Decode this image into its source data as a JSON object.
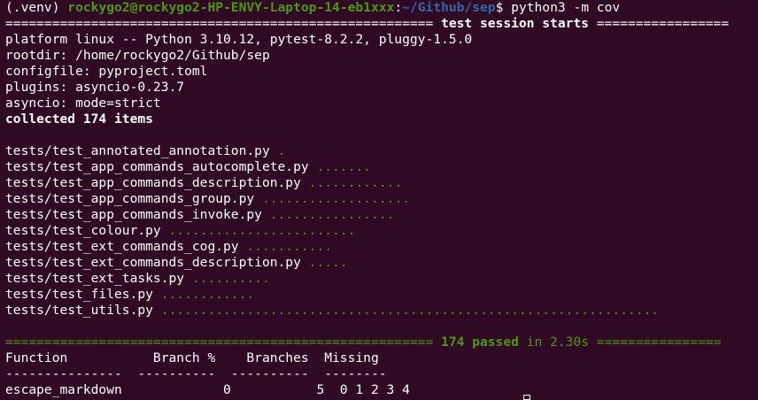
{
  "prompt": {
    "venv": "(.venv) ",
    "user_host": "rockygo2@rockygo2-HP-ENVY-Laptop-14-eb1xxx",
    "colon": ":",
    "path": "~/Github/sep",
    "symbol": "$ ",
    "command": "python3 -m cov"
  },
  "session": {
    "banner_left": "=======================================================",
    "banner_title": " test session starts ",
    "banner_right": "=================",
    "platform": "platform linux -- Python 3.10.12, pytest-8.2.2, pluggy-1.5.0",
    "rootdir": "rootdir: /home/rockygo2/Github/sep",
    "configfile": "configfile: pyproject.toml",
    "plugins": "plugins: asyncio-0.23.7",
    "asyncio": "asyncio: mode=strict",
    "collected": "collected 174 items"
  },
  "tests": [
    {
      "file": "tests/test_annotated_annotation.py ",
      "dots": "."
    },
    {
      "file": "tests/test_app_commands_autocomplete.py ",
      "dots": "......."
    },
    {
      "file": "tests/test_app_commands_description.py ",
      "dots": "............"
    },
    {
      "file": "tests/test_app_commands_group.py ",
      "dots": "..................."
    },
    {
      "file": "tests/test_app_commands_invoke.py ",
      "dots": "................"
    },
    {
      "file": "tests/test_colour.py ",
      "dots": "........................"
    },
    {
      "file": "tests/test_ext_commands_cog.py ",
      "dots": "..........."
    },
    {
      "file": "tests/test_ext_commands_description.py ",
      "dots": "....."
    },
    {
      "file": "tests/test_ext_tasks.py ",
      "dots": ".........."
    },
    {
      "file": "tests/test_files.py ",
      "dots": "............"
    },
    {
      "file": "tests/test_utils.py ",
      "dots": "................................................................"
    }
  ],
  "summary": {
    "left": "=======================================================",
    "passed": " 174 passed",
    "in_time": " in 2.30s ",
    "right": "================"
  },
  "coverage": {
    "header": "Function           Branch %    Branches  Missing",
    "separator": "---------------  ----------  ----------  --------",
    "rows": [
      {
        "text": "escape_markdown             0           5  0 1 2 3 4"
      }
    ]
  },
  "colors": {
    "background": "#300a24",
    "prompt_user": "#4e9a06",
    "prompt_path": "#3465a4",
    "passed": "#4e9a06",
    "text": "#ffffff"
  }
}
